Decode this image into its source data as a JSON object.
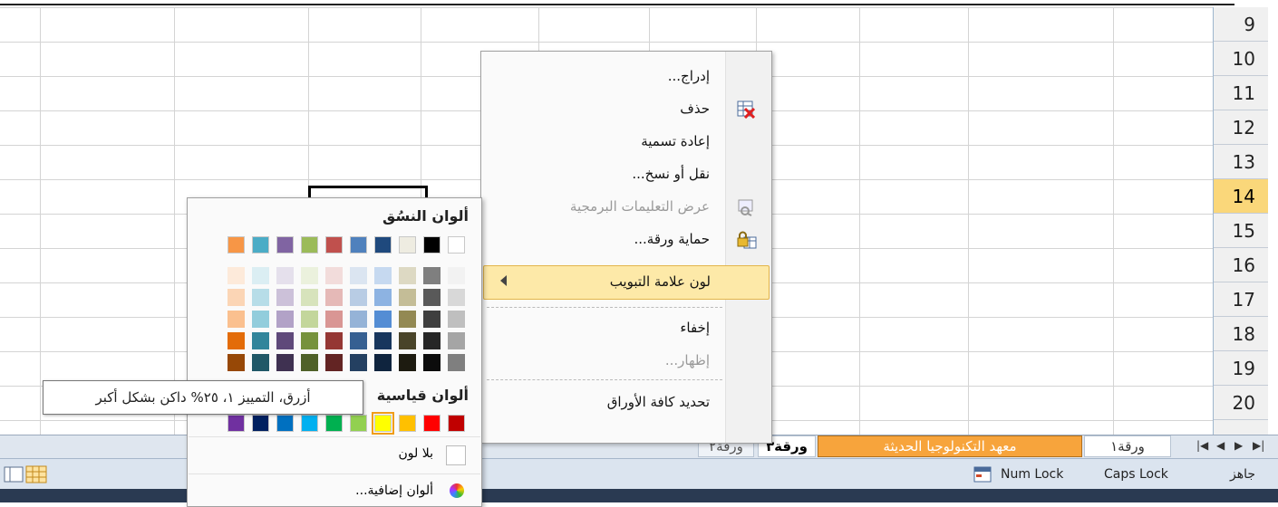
{
  "row_numbers": [
    "9",
    "10",
    "11",
    "12",
    "13",
    "14",
    "15",
    "16",
    "17",
    "18",
    "19",
    "20"
  ],
  "active_row": "14",
  "context_menu": {
    "items": [
      {
        "label": "إدراج...",
        "enabled": true,
        "icon": "none"
      },
      {
        "label": "حذف",
        "enabled": true,
        "icon": "delete-sheet-icon"
      },
      {
        "label": "إعادة تسمية",
        "enabled": true,
        "icon": "none"
      },
      {
        "label": "نقل أو نسخ...",
        "enabled": true,
        "icon": "none"
      },
      {
        "label": "عرض التعليمات البرمجية",
        "enabled": false,
        "icon": "view-code-icon"
      },
      {
        "label": "حماية ورقة...",
        "enabled": true,
        "icon": "protect-sheet-icon"
      },
      {
        "label": "لون علامة التبويب",
        "enabled": true,
        "icon": "none",
        "highlighted": true,
        "submenu": true
      },
      {
        "label": "إخفاء",
        "enabled": true,
        "icon": "none"
      },
      {
        "label": "إظهار...",
        "enabled": false,
        "icon": "none"
      },
      {
        "label": "تحديد كافة الأوراق",
        "enabled": true,
        "icon": "none"
      }
    ]
  },
  "color_menu": {
    "theme_header": "ألوان النسُق",
    "standard_header": "ألوان قياسية",
    "theme_colors": [
      "#ffffff",
      "#000000",
      "#eeece1",
      "#1f497d",
      "#4f81bd",
      "#c0504d",
      "#9bbb59",
      "#8064a2",
      "#4bacc6",
      "#f79646"
    ],
    "theme_shades": [
      [
        "#f2f2f2",
        "#d8d8d8",
        "#bfbfbf",
        "#a5a5a5",
        "#7f7f7f"
      ],
      [
        "#7f7f7f",
        "#595959",
        "#3f3f3f",
        "#262626",
        "#0c0c0c"
      ],
      [
        "#ddd9c3",
        "#c4bd97",
        "#938953",
        "#494429",
        "#1d1b10"
      ],
      [
        "#c6d9f0",
        "#8db3e2",
        "#548dd4",
        "#17365d",
        "#0f243e"
      ],
      [
        "#dbe5f1",
        "#b8cce4",
        "#95b3d7",
        "#366092",
        "#244061"
      ],
      [
        "#f2dcdb",
        "#e5b9b7",
        "#d99694",
        "#953734",
        "#632423"
      ],
      [
        "#ebf1dd",
        "#d7e3bc",
        "#c3d69b",
        "#76923c",
        "#4f6128"
      ],
      [
        "#e5e0ec",
        "#ccc1d9",
        "#b2a2c7",
        "#5f497a",
        "#3f3151"
      ],
      [
        "#dbeef3",
        "#b7dde8",
        "#92cddc",
        "#31859b",
        "#205867"
      ],
      [
        "#fdeada",
        "#fbd5b5",
        "#fac08f",
        "#e36c09",
        "#974806"
      ]
    ],
    "standard_colors": [
      "#c00000",
      "#ff0000",
      "#ffc000",
      "#ffff00",
      "#92d050",
      "#00b050",
      "#00b0f0",
      "#0070c0",
      "#002060",
      "#7030a0"
    ],
    "selected_standard_index": 3,
    "no_color_label": "بلا لون",
    "more_colors_label": "ألوان إضافية..."
  },
  "tooltip": "أزرق، التمييز ١، ٢٥% داكن بشكل أكبر",
  "sheet_tabs": {
    "worksheet1": "ورقة١",
    "active": "معهد التكنولوجيا الحديثة",
    "hidden_partial": [
      "ورقة٢",
      "ورقة٣"
    ]
  },
  "status_bar": {
    "ready": "جاهز",
    "caps_lock": "Caps Lock",
    "num_lock": "Num Lock"
  }
}
